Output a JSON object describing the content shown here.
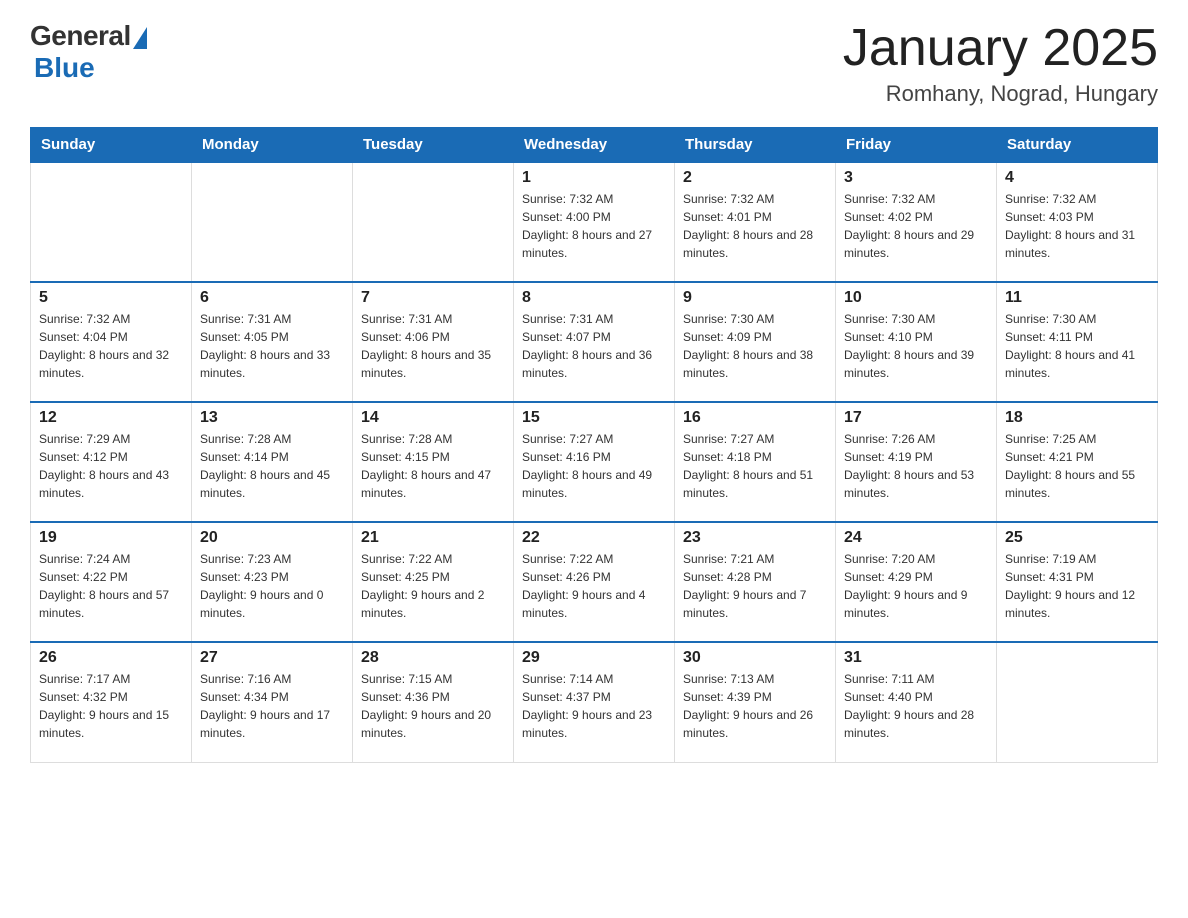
{
  "header": {
    "logo_general": "General",
    "logo_blue": "Blue",
    "title": "January 2025",
    "subtitle": "Romhany, Nograd, Hungary"
  },
  "days_of_week": [
    "Sunday",
    "Monday",
    "Tuesday",
    "Wednesday",
    "Thursday",
    "Friday",
    "Saturday"
  ],
  "weeks": [
    [
      {
        "day": "",
        "sunrise": "",
        "sunset": "",
        "daylight": ""
      },
      {
        "day": "",
        "sunrise": "",
        "sunset": "",
        "daylight": ""
      },
      {
        "day": "",
        "sunrise": "",
        "sunset": "",
        "daylight": ""
      },
      {
        "day": "1",
        "sunrise": "Sunrise: 7:32 AM",
        "sunset": "Sunset: 4:00 PM",
        "daylight": "Daylight: 8 hours and 27 minutes."
      },
      {
        "day": "2",
        "sunrise": "Sunrise: 7:32 AM",
        "sunset": "Sunset: 4:01 PM",
        "daylight": "Daylight: 8 hours and 28 minutes."
      },
      {
        "day": "3",
        "sunrise": "Sunrise: 7:32 AM",
        "sunset": "Sunset: 4:02 PM",
        "daylight": "Daylight: 8 hours and 29 minutes."
      },
      {
        "day": "4",
        "sunrise": "Sunrise: 7:32 AM",
        "sunset": "Sunset: 4:03 PM",
        "daylight": "Daylight: 8 hours and 31 minutes."
      }
    ],
    [
      {
        "day": "5",
        "sunrise": "Sunrise: 7:32 AM",
        "sunset": "Sunset: 4:04 PM",
        "daylight": "Daylight: 8 hours and 32 minutes."
      },
      {
        "day": "6",
        "sunrise": "Sunrise: 7:31 AM",
        "sunset": "Sunset: 4:05 PM",
        "daylight": "Daylight: 8 hours and 33 minutes."
      },
      {
        "day": "7",
        "sunrise": "Sunrise: 7:31 AM",
        "sunset": "Sunset: 4:06 PM",
        "daylight": "Daylight: 8 hours and 35 minutes."
      },
      {
        "day": "8",
        "sunrise": "Sunrise: 7:31 AM",
        "sunset": "Sunset: 4:07 PM",
        "daylight": "Daylight: 8 hours and 36 minutes."
      },
      {
        "day": "9",
        "sunrise": "Sunrise: 7:30 AM",
        "sunset": "Sunset: 4:09 PM",
        "daylight": "Daylight: 8 hours and 38 minutes."
      },
      {
        "day": "10",
        "sunrise": "Sunrise: 7:30 AM",
        "sunset": "Sunset: 4:10 PM",
        "daylight": "Daylight: 8 hours and 39 minutes."
      },
      {
        "day": "11",
        "sunrise": "Sunrise: 7:30 AM",
        "sunset": "Sunset: 4:11 PM",
        "daylight": "Daylight: 8 hours and 41 minutes."
      }
    ],
    [
      {
        "day": "12",
        "sunrise": "Sunrise: 7:29 AM",
        "sunset": "Sunset: 4:12 PM",
        "daylight": "Daylight: 8 hours and 43 minutes."
      },
      {
        "day": "13",
        "sunrise": "Sunrise: 7:28 AM",
        "sunset": "Sunset: 4:14 PM",
        "daylight": "Daylight: 8 hours and 45 minutes."
      },
      {
        "day": "14",
        "sunrise": "Sunrise: 7:28 AM",
        "sunset": "Sunset: 4:15 PM",
        "daylight": "Daylight: 8 hours and 47 minutes."
      },
      {
        "day": "15",
        "sunrise": "Sunrise: 7:27 AM",
        "sunset": "Sunset: 4:16 PM",
        "daylight": "Daylight: 8 hours and 49 minutes."
      },
      {
        "day": "16",
        "sunrise": "Sunrise: 7:27 AM",
        "sunset": "Sunset: 4:18 PM",
        "daylight": "Daylight: 8 hours and 51 minutes."
      },
      {
        "day": "17",
        "sunrise": "Sunrise: 7:26 AM",
        "sunset": "Sunset: 4:19 PM",
        "daylight": "Daylight: 8 hours and 53 minutes."
      },
      {
        "day": "18",
        "sunrise": "Sunrise: 7:25 AM",
        "sunset": "Sunset: 4:21 PM",
        "daylight": "Daylight: 8 hours and 55 minutes."
      }
    ],
    [
      {
        "day": "19",
        "sunrise": "Sunrise: 7:24 AM",
        "sunset": "Sunset: 4:22 PM",
        "daylight": "Daylight: 8 hours and 57 minutes."
      },
      {
        "day": "20",
        "sunrise": "Sunrise: 7:23 AM",
        "sunset": "Sunset: 4:23 PM",
        "daylight": "Daylight: 9 hours and 0 minutes."
      },
      {
        "day": "21",
        "sunrise": "Sunrise: 7:22 AM",
        "sunset": "Sunset: 4:25 PM",
        "daylight": "Daylight: 9 hours and 2 minutes."
      },
      {
        "day": "22",
        "sunrise": "Sunrise: 7:22 AM",
        "sunset": "Sunset: 4:26 PM",
        "daylight": "Daylight: 9 hours and 4 minutes."
      },
      {
        "day": "23",
        "sunrise": "Sunrise: 7:21 AM",
        "sunset": "Sunset: 4:28 PM",
        "daylight": "Daylight: 9 hours and 7 minutes."
      },
      {
        "day": "24",
        "sunrise": "Sunrise: 7:20 AM",
        "sunset": "Sunset: 4:29 PM",
        "daylight": "Daylight: 9 hours and 9 minutes."
      },
      {
        "day": "25",
        "sunrise": "Sunrise: 7:19 AM",
        "sunset": "Sunset: 4:31 PM",
        "daylight": "Daylight: 9 hours and 12 minutes."
      }
    ],
    [
      {
        "day": "26",
        "sunrise": "Sunrise: 7:17 AM",
        "sunset": "Sunset: 4:32 PM",
        "daylight": "Daylight: 9 hours and 15 minutes."
      },
      {
        "day": "27",
        "sunrise": "Sunrise: 7:16 AM",
        "sunset": "Sunset: 4:34 PM",
        "daylight": "Daylight: 9 hours and 17 minutes."
      },
      {
        "day": "28",
        "sunrise": "Sunrise: 7:15 AM",
        "sunset": "Sunset: 4:36 PM",
        "daylight": "Daylight: 9 hours and 20 minutes."
      },
      {
        "day": "29",
        "sunrise": "Sunrise: 7:14 AM",
        "sunset": "Sunset: 4:37 PM",
        "daylight": "Daylight: 9 hours and 23 minutes."
      },
      {
        "day": "30",
        "sunrise": "Sunrise: 7:13 AM",
        "sunset": "Sunset: 4:39 PM",
        "daylight": "Daylight: 9 hours and 26 minutes."
      },
      {
        "day": "31",
        "sunrise": "Sunrise: 7:11 AM",
        "sunset": "Sunset: 4:40 PM",
        "daylight": "Daylight: 9 hours and 28 minutes."
      },
      {
        "day": "",
        "sunrise": "",
        "sunset": "",
        "daylight": ""
      }
    ]
  ]
}
